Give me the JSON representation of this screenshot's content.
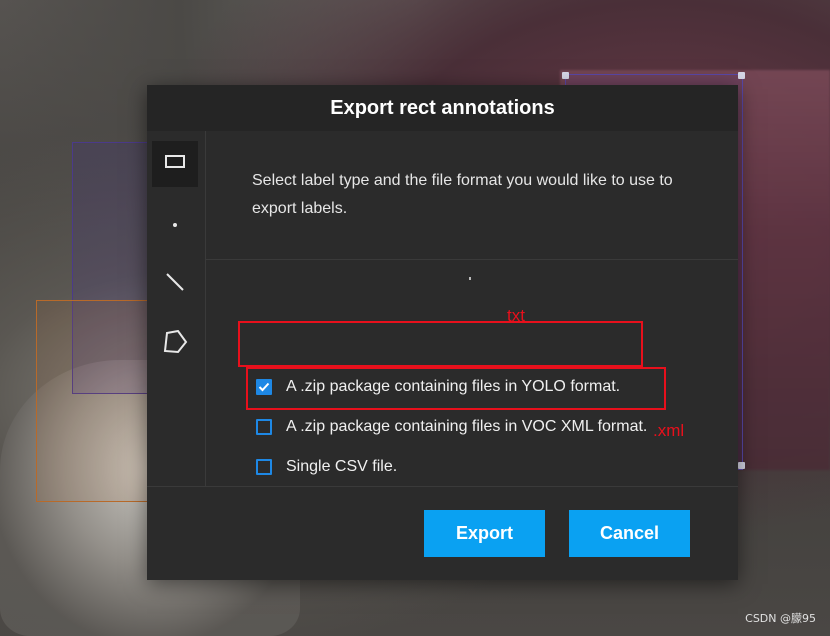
{
  "dialog": {
    "title": "Export rect annotations",
    "description": "Select label type and the file format you would like to use to export labels.",
    "label_types": [
      {
        "name": "rect-icon",
        "active": true
      },
      {
        "name": "point-icon",
        "active": false
      },
      {
        "name": "line-icon",
        "active": false
      },
      {
        "name": "polygon-icon",
        "active": false
      }
    ],
    "options": [
      {
        "label": "A .zip package containing files in YOLO format.",
        "checked": true
      },
      {
        "label": "A .zip package containing files in VOC XML format.",
        "checked": false
      },
      {
        "label": "Single CSV file.",
        "checked": false
      }
    ],
    "export_label": "Export",
    "cancel_label": "Cancel"
  },
  "annotations": {
    "yolo_note": "txt",
    "voc_note": ".xml"
  },
  "watermark": "CSDN @朦95",
  "colors": {
    "accent": "#0aa1f2",
    "checkbox": "#1e88e5",
    "annotation": "#e8101c",
    "modal_bg": "#2b2b2b"
  }
}
